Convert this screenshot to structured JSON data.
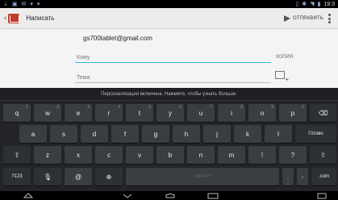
{
  "status_bar": {
    "time": "19:3"
  },
  "action_bar": {
    "title": "Написать",
    "send_label": "ОТПРАВИТЬ"
  },
  "compose": {
    "from": "gs700tablet@gmail.com",
    "to_placeholder": "Кому",
    "cc_label": "КОПИЯ",
    "subject_placeholder": "Тема"
  },
  "keyboard": {
    "hint": "Персонализация включена. Нажмите, чтобы узнать больше.",
    "row1": [
      {
        "label": "q",
        "sub": "1"
      },
      {
        "label": "w",
        "sub": "2"
      },
      {
        "label": "e",
        "sub": "3"
      },
      {
        "label": "r",
        "sub": "4"
      },
      {
        "label": "t",
        "sub": "5"
      },
      {
        "label": "y",
        "sub": "6"
      },
      {
        "label": "u",
        "sub": "7"
      },
      {
        "label": "i",
        "sub": "8"
      },
      {
        "label": "o",
        "sub": "9"
      },
      {
        "label": "p",
        "sub": "0"
      }
    ],
    "row2": [
      "a",
      "s",
      "d",
      "f",
      "g",
      "h",
      "j",
      "k",
      "l"
    ],
    "row3": [
      "z",
      "x",
      "c",
      "v",
      "b",
      "n",
      "m",
      "!",
      "?"
    ],
    "done_label": "Готово",
    "symbols_label": "?123",
    "at_label": "@",
    "space_label": "SWERTY",
    "dot_label": ".",
    "dash_label": "-",
    "com_label": ".com"
  }
}
